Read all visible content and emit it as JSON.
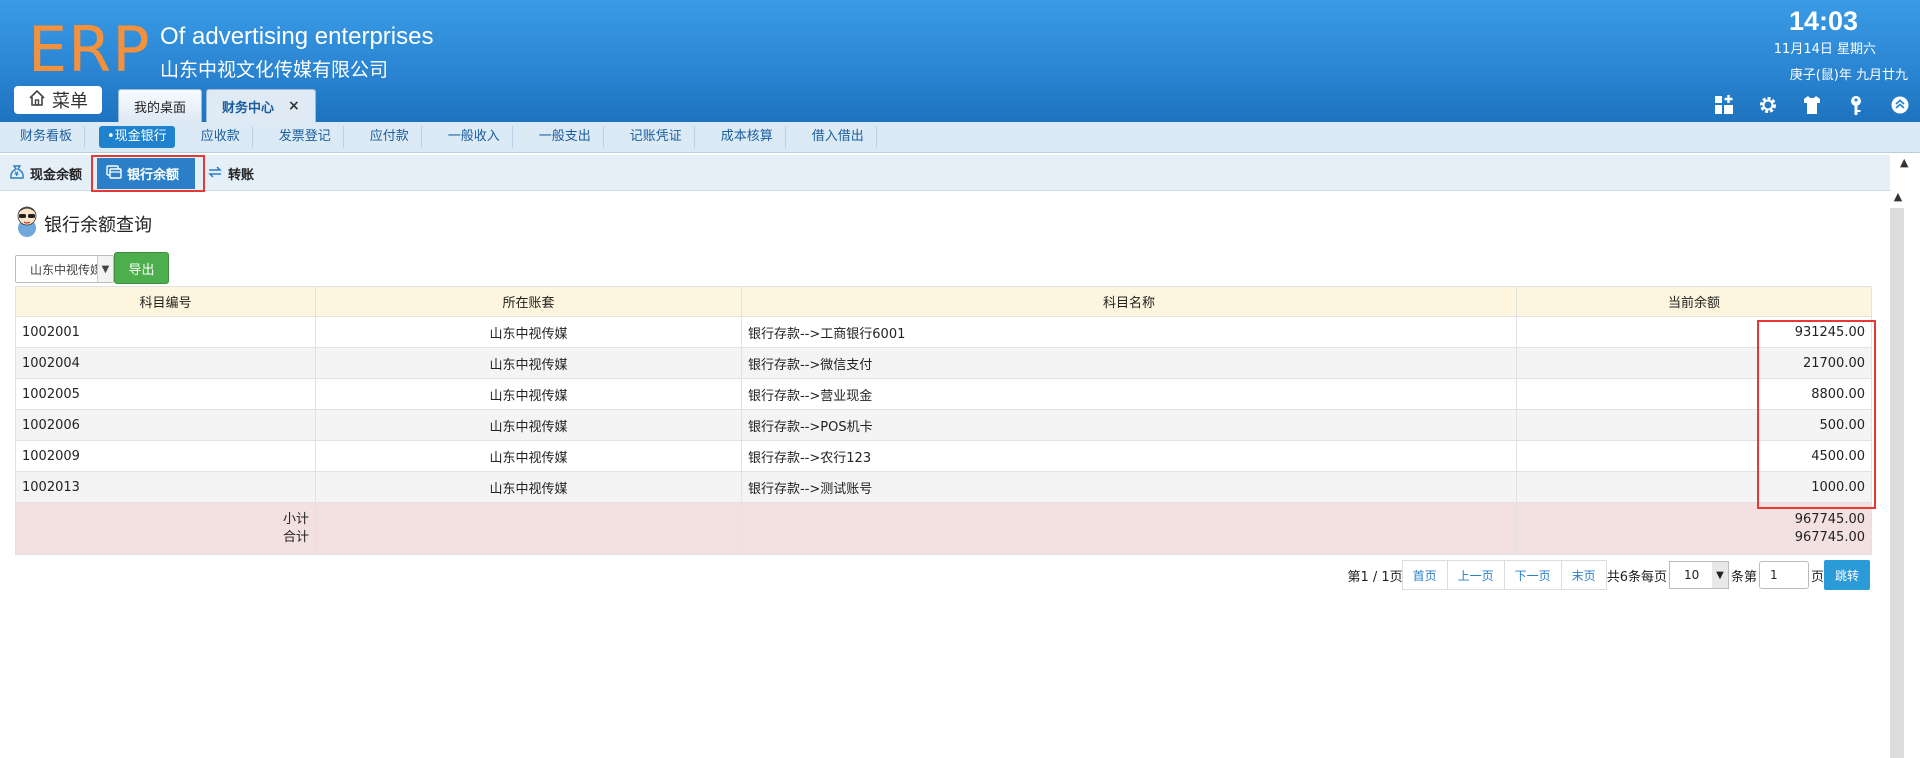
{
  "header": {
    "logo": "ERP",
    "company_en": "Of advertising enterprises",
    "company_cn": "山东中视文化传媒有限公司",
    "time": "14:03",
    "date": "11月14日 星期六",
    "lunar": "庚子(鼠)年 九月廿九",
    "menu_label": "菜单",
    "tabs": [
      {
        "label": "我的桌面"
      },
      {
        "label": "财务中心",
        "close": "×"
      }
    ],
    "icons": [
      "add-widget-icon",
      "gear-icon",
      "shirt-icon",
      "key-icon",
      "collapse-up-icon"
    ],
    "accent": "#2b86d3",
    "logo_color": "#f4913c"
  },
  "modules": [
    "财务看板",
    "•现金银行",
    "应收款",
    "发票登记",
    "应付款",
    "一般收入",
    "一般支出",
    "记账凭证",
    "成本核算",
    "借入借出"
  ],
  "subnav": [
    "现金余额",
    "银行余额",
    "转账"
  ],
  "page": {
    "title": "银行余额查询",
    "select_value": "山东中视传媒",
    "export_label": "导出"
  },
  "table": {
    "headers": [
      "科目编号",
      "所在账套",
      "科目名称",
      "当前余额"
    ],
    "rows": [
      {
        "code": "1002001",
        "book": "山东中视传媒",
        "name": "银行存款-->工商银行6001",
        "balance": "931245.00"
      },
      {
        "code": "1002004",
        "book": "山东中视传媒",
        "name": "银行存款-->微信支付",
        "balance": "21700.00"
      },
      {
        "code": "1002005",
        "book": "山东中视传媒",
        "name": "银行存款-->营业现金",
        "balance": "8800.00"
      },
      {
        "code": "1002006",
        "book": "山东中视传媒",
        "name": "银行存款-->POS机卡",
        "balance": "500.00"
      },
      {
        "code": "1002009",
        "book": "山东中视传媒",
        "name": "银行存款-->农行123",
        "balance": "4500.00"
      },
      {
        "code": "1002013",
        "book": "山东中视传媒",
        "name": "银行存款-->测试账号",
        "balance": "1000.00"
      }
    ],
    "subtotal_label": "小计",
    "total_label": "合计",
    "subtotal": "967745.00",
    "total": "967745.00"
  },
  "pager": {
    "page_info": "第1 / 1页",
    "first": "首页",
    "prev": "上一页",
    "next": "下一页",
    "last": "末页",
    "total_info": "共6条每页",
    "page_size": "10",
    "per_suffix": "条第",
    "page_input": "1",
    "page_suffix": "页",
    "go": "跳转"
  }
}
